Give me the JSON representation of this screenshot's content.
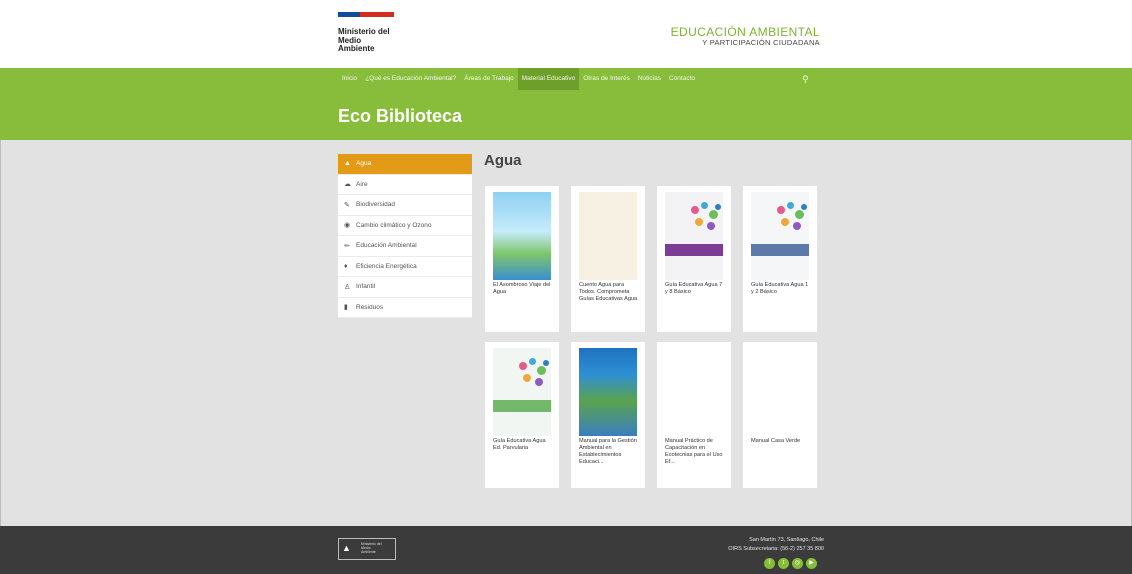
{
  "header": {
    "ministry_logo_text": "Ministerio del\nMedio\nAmbiente",
    "brand_title": "EDUCACIÓN AMBIENTAL",
    "brand_subtitle": "Y PARTICIPACIÓN CIUDADANA"
  },
  "nav": {
    "items": [
      {
        "label": "Inicio",
        "active": false
      },
      {
        "label": "¿Qué es Educación Ambiental?",
        "active": false
      },
      {
        "label": "Áreas de Trabajo",
        "active": false
      },
      {
        "label": "Material Educativo",
        "active": true
      },
      {
        "label": "Otras de Interés",
        "active": false
      },
      {
        "label": "Noticias",
        "active": false
      },
      {
        "label": "Contacto",
        "active": false
      }
    ],
    "search_icon": "search-icon"
  },
  "hero": {
    "title": "Eco Biblioteca"
  },
  "sidebar": {
    "items": [
      {
        "label": "Agua",
        "icon": "droplet-icon",
        "glyph": "▲",
        "active": true
      },
      {
        "label": "Aire",
        "icon": "cloud-icon",
        "glyph": "☁",
        "active": false
      },
      {
        "label": "Biodiversidad",
        "icon": "leaf-icon",
        "glyph": "✎",
        "active": false
      },
      {
        "label": "Cambio climático y Ozono",
        "icon": "globe-icon",
        "glyph": "◉",
        "active": false
      },
      {
        "label": "Educación Ambiental",
        "icon": "pencil-icon",
        "glyph": "✏",
        "active": false
      },
      {
        "label": "Eficiencia Energética",
        "icon": "bulb-icon",
        "glyph": "♦",
        "active": false
      },
      {
        "label": "Infantil",
        "icon": "child-icon",
        "glyph": "♙",
        "active": false
      },
      {
        "label": "Residuos",
        "icon": "trash-icon",
        "glyph": "▮",
        "active": false
      }
    ]
  },
  "main": {
    "section_title": "Agua",
    "cards": [
      {
        "title": "El Asombroso Viaje del Agua",
        "cover": "c-blue"
      },
      {
        "title": "Cuento Agua para Todos. Comprometa Guías Educativas Agua",
        "cover": "c-cream"
      },
      {
        "title": "Guía Educativa Agua 7 y 8 Básico",
        "cover": "c-purple"
      },
      {
        "title": "Guía Educativa Agua 1 y 2 Básico",
        "cover": "c-grayblue"
      },
      {
        "title": "Guía Educativa Agua Ed. Parvularia",
        "cover": "c-green"
      },
      {
        "title": "Manual para la Gestión Ambiental en Establecimientos Educaci...",
        "cover": "c-photo"
      },
      {
        "title": "Manual Práctico de Capacitación en Ecotecnias para el Uso Ef...",
        "cover": "c-white"
      },
      {
        "title": "Manual Casa Verde",
        "cover": "c-white"
      }
    ]
  },
  "footer": {
    "logo_text": "Ministerio del\nMedio\nAmbiente",
    "address_line1": "San Martín 73, Santiago, Chile",
    "address_line2": "OIRS Subsecretaria: (56-2) 257 35 800",
    "socials": [
      {
        "icon": "facebook-icon",
        "glyph": "f"
      },
      {
        "icon": "twitter-icon",
        "glyph": "t"
      },
      {
        "icon": "instagram-icon",
        "glyph": "◎"
      },
      {
        "icon": "youtube-icon",
        "glyph": "▶"
      }
    ]
  },
  "colors": {
    "accent_green": "#87bd3a",
    "active_orange": "#e39a17",
    "page_bg": "#e2e2e2",
    "footer_bg": "#3b3b3b"
  }
}
